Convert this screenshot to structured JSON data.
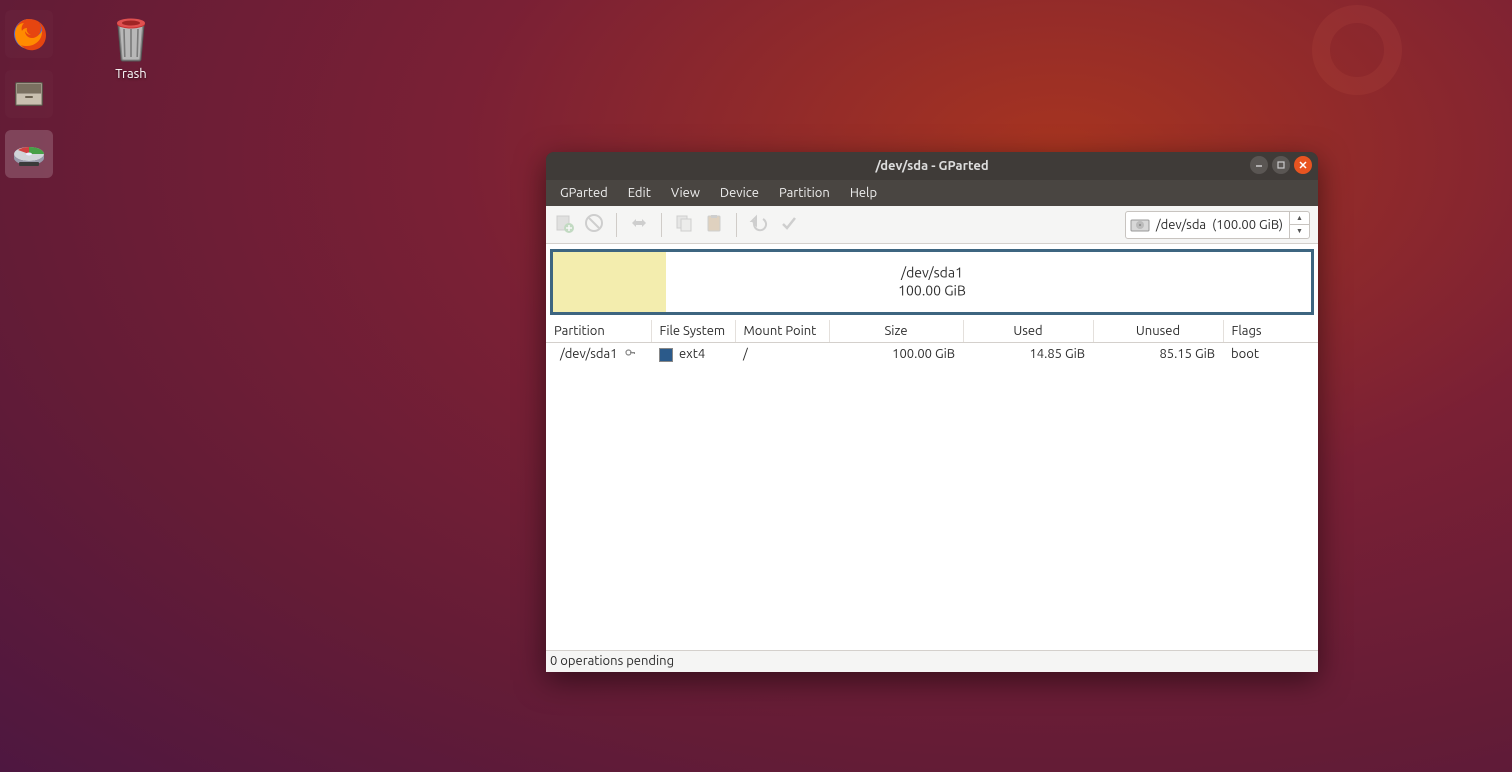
{
  "desktop": {
    "trash_label": "Trash"
  },
  "launcher": {
    "items": [
      "firefox",
      "files",
      "gparted"
    ]
  },
  "window": {
    "title": "/dev/sda - GParted",
    "menus": [
      "GParted",
      "Edit",
      "View",
      "Device",
      "Partition",
      "Help"
    ],
    "device_selector": {
      "device": "/dev/sda",
      "size": "(100.00 GiB)"
    },
    "visual": {
      "partition": "/dev/sda1",
      "size": "100.00 GiB",
      "used_fraction": 0.1485
    },
    "table": {
      "headers": [
        "Partition",
        "File System",
        "Mount Point",
        "Size",
        "Used",
        "Unused",
        "Flags"
      ],
      "rows": [
        {
          "partition": "/dev/sda1",
          "locked": true,
          "filesystem": "ext4",
          "fs_color": "#2b5a8a",
          "mount_point": "/",
          "size": "100.00 GiB",
          "used": "14.85 GiB",
          "unused": "85.15 GiB",
          "flags": "boot"
        }
      ]
    },
    "status": "0 operations pending"
  }
}
